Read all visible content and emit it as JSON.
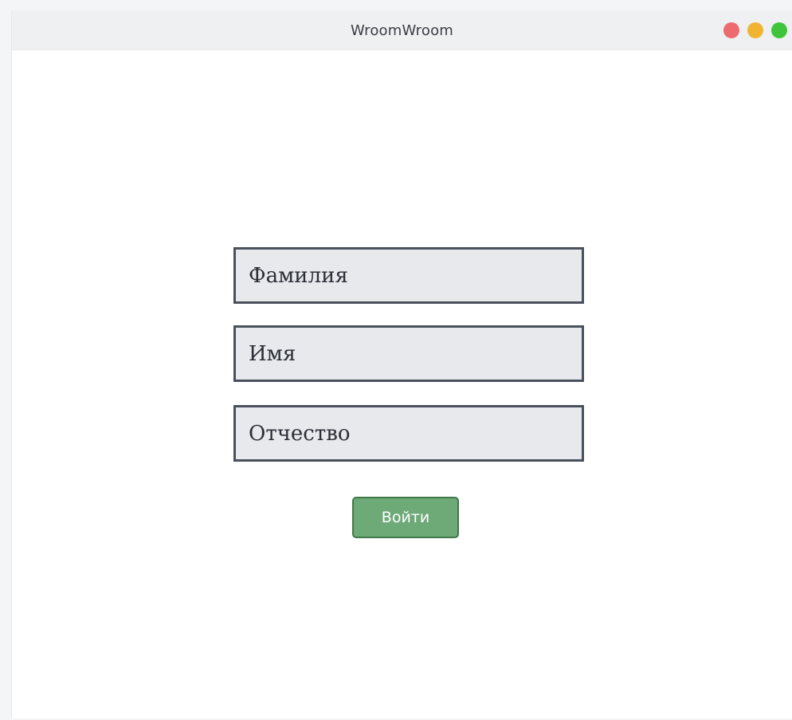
{
  "window": {
    "title": "WroomWroom",
    "controls": {
      "close_color": "#ed6a6e",
      "minimize_color": "#f0b433",
      "maximize_color": "#3ec53b"
    }
  },
  "form": {
    "fields": [
      {
        "name": "surname",
        "placeholder": "Фамилия"
      },
      {
        "name": "first_name",
        "placeholder": "Имя"
      },
      {
        "name": "patronymic",
        "placeholder": "Отчество"
      }
    ],
    "submit_label": "Войти",
    "colors": {
      "field_bg": "#e7e9ed",
      "field_border": "#4a515c",
      "button_bg": "#6daa78",
      "button_border": "#3f7a48"
    }
  }
}
